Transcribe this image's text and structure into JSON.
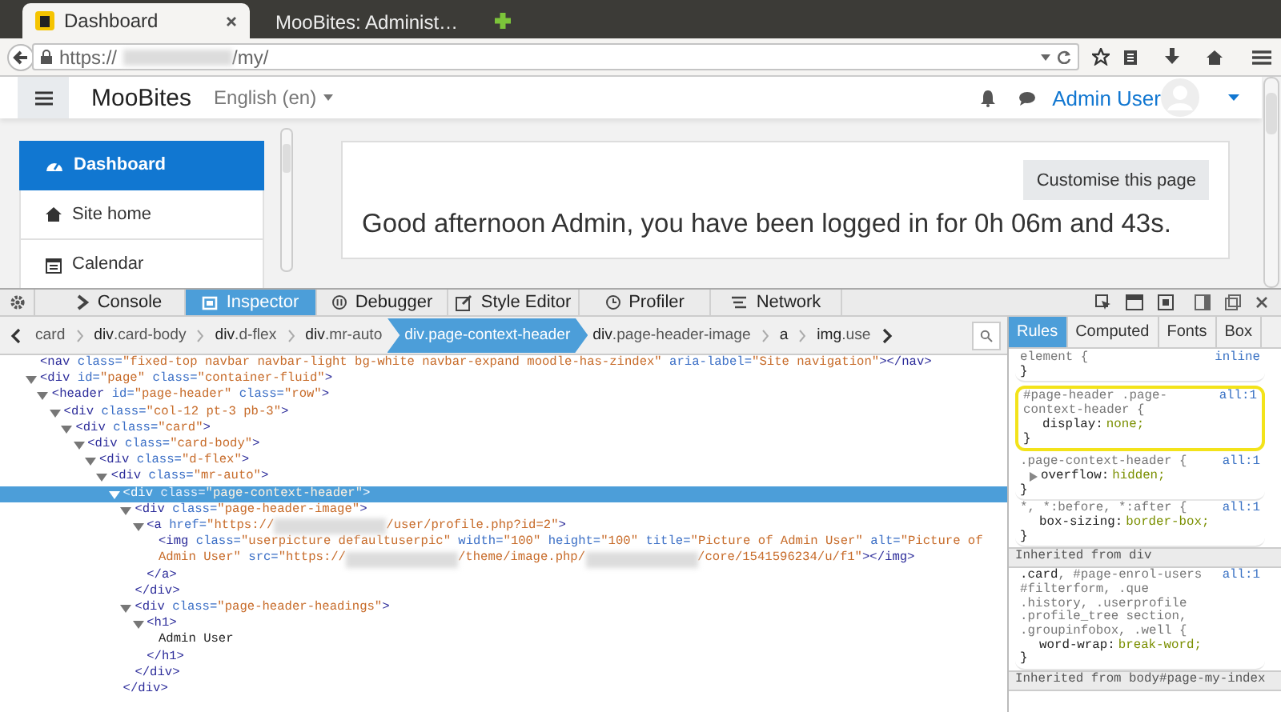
{
  "browser": {
    "tabs": [
      {
        "title": "Dashboard",
        "selected": true
      },
      {
        "title": "MooBites: Administ…",
        "selected": false
      }
    ],
    "url": {
      "prefix": "https://",
      "suffix": "/my/"
    }
  },
  "header": {
    "site_name": "MooBites",
    "language": "English (en)",
    "user_name": "Admin User"
  },
  "sidebar": {
    "items": [
      {
        "label": "Dashboard",
        "kind": "dashboard",
        "selected": true
      },
      {
        "label": "Site home",
        "kind": "home",
        "selected": false
      },
      {
        "label": "Calendar",
        "kind": "calendar",
        "selected": false
      }
    ]
  },
  "content": {
    "button": "Customise this page",
    "greeting": "Good afternoon Admin, you have been logged in for 0h 06m and 43s."
  },
  "devtools": {
    "tabs": [
      {
        "label": "Console",
        "kind": "console",
        "selected": false
      },
      {
        "label": "Inspector",
        "kind": "inspector",
        "selected": true
      },
      {
        "label": "Debugger",
        "kind": "debugger",
        "selected": false
      },
      {
        "label": "Style Editor",
        "kind": "style",
        "selected": false
      },
      {
        "label": "Profiler",
        "kind": "profiler",
        "selected": false
      },
      {
        "label": "Network",
        "kind": "network",
        "selected": false
      }
    ],
    "breadcrumbs": [
      {
        "cls": "card",
        "selected": false
      },
      {
        "tag": "div",
        "cls": ".card-body",
        "selected": false
      },
      {
        "tag": "div",
        "cls": ".d-flex",
        "selected": false
      },
      {
        "tag": "div",
        "cls": ".mr-auto",
        "selected": false
      },
      {
        "tag": "div",
        "cls": ".page-context-header",
        "selected": true
      },
      {
        "tag": "div",
        "cls": ".page-header-image",
        "selected": false
      },
      {
        "tag": "a",
        "selected": false
      },
      {
        "tag": "img",
        "cls": ".use",
        "selected": false
      }
    ],
    "markup": [
      {
        "open": [
          {
            "kind": "tag",
            "text": "<nav"
          },
          {
            "kind": "attr",
            "text": " class="
          },
          {
            "kind": "value",
            "text": "\"fixed-top navbar navbar-light bg-white navbar-expand moodle-has-zindex\""
          },
          {
            "kind": "attr",
            "text": " aria-label="
          },
          {
            "kind": "value",
            "text": "\"Site navigation\""
          },
          {
            "kind": "tag",
            "text": "></nav>"
          }
        ],
        "selected": false
      },
      {
        "open": [
          {
            "kind": "tag",
            "text": "<div"
          },
          {
            "kind": "attr",
            "text": " id="
          },
          {
            "kind": "value",
            "text": "\"page\""
          },
          {
            "kind": "attr",
            "text": " class="
          },
          {
            "kind": "value",
            "text": "\"container-fluid\""
          },
          {
            "kind": "tag",
            "text": ">"
          }
        ],
        "selected": false,
        "expanded": true,
        "children": [
          {
            "open": [
              {
                "kind": "tag",
                "text": "<header"
              },
              {
                "kind": "attr",
                "text": " id="
              },
              {
                "kind": "value",
                "text": "\"page-header\""
              },
              {
                "kind": "attr",
                "text": " class="
              },
              {
                "kind": "value",
                "text": "\"row\""
              },
              {
                "kind": "tag",
                "text": ">"
              }
            ],
            "selected": false,
            "expanded": true,
            "children": [
              {
                "open": [
                  {
                    "kind": "tag",
                    "text": "<div"
                  },
                  {
                    "kind": "attr",
                    "text": " class="
                  },
                  {
                    "kind": "value",
                    "text": "\"col-12 pt-3 pb-3\""
                  },
                  {
                    "kind": "tag",
                    "text": ">"
                  }
                ],
                "selected": false,
                "expanded": true,
                "children": [
                  {
                    "open": [
                      {
                        "kind": "tag",
                        "text": "<div"
                      },
                      {
                        "kind": "attr",
                        "text": " class="
                      },
                      {
                        "kind": "value",
                        "text": "\"card\""
                      },
                      {
                        "kind": "tag",
                        "text": ">"
                      }
                    ],
                    "selected": false,
                    "expanded": true,
                    "children": [
                      {
                        "open": [
                          {
                            "kind": "tag",
                            "text": "<div"
                          },
                          {
                            "kind": "attr",
                            "text": " class="
                          },
                          {
                            "kind": "value",
                            "text": "\"card-body\""
                          },
                          {
                            "kind": "tag",
                            "text": ">"
                          }
                        ],
                        "selected": false,
                        "expanded": true,
                        "children": [
                          {
                            "open": [
                              {
                                "kind": "tag",
                                "text": "<div"
                              },
                              {
                                "kind": "attr",
                                "text": " class="
                              },
                              {
                                "kind": "value",
                                "text": "\"d-flex\""
                              },
                              {
                                "kind": "tag",
                                "text": ">"
                              }
                            ],
                            "selected": false,
                            "expanded": true,
                            "children": [
                              {
                                "open": [
                                  {
                                    "kind": "tag",
                                    "text": "<div"
                                  },
                                  {
                                    "kind": "attr",
                                    "text": " class="
                                  },
                                  {
                                    "kind": "value",
                                    "text": "\"mr-auto\""
                                  },
                                  {
                                    "kind": "tag",
                                    "text": ">"
                                  }
                                ],
                                "selected": false,
                                "expanded": true,
                                "children": [
                                  {
                                    "open": [
                                      {
                                        "kind": "tag",
                                        "text": "<div"
                                      },
                                      {
                                        "kind": "attr",
                                        "text": " class="
                                      },
                                      {
                                        "kind": "value",
                                        "text": "\"page-context-header\""
                                      },
                                      {
                                        "kind": "tag",
                                        "text": ">"
                                      }
                                    ],
                                    "selected": true,
                                    "expanded": true,
                                    "close": [
                                      {
                                        "kind": "tag",
                                        "text": "</div>"
                                      }
                                    ],
                                    "children": [
                                      {
                                        "open": [
                                          {
                                            "kind": "tag",
                                            "text": "<div"
                                          },
                                          {
                                            "kind": "attr",
                                            "text": " class="
                                          },
                                          {
                                            "kind": "value",
                                            "text": "\"page-header-image\""
                                          },
                                          {
                                            "kind": "tag",
                                            "text": ">"
                                          }
                                        ],
                                        "selected": false,
                                        "expanded": true,
                                        "close": [
                                          {
                                            "kind": "tag",
                                            "text": "</div>"
                                          }
                                        ],
                                        "children": [
                                          {
                                            "open": [
                                              {
                                                "kind": "tag",
                                                "text": "<a"
                                              },
                                              {
                                                "kind": "attr",
                                                "text": " href="
                                              },
                                              {
                                                "kind": "value",
                                                "text": "\"https://"
                                              },
                                              {
                                                "kind": "redacted"
                                              },
                                              {
                                                "kind": "value",
                                                "text": "/user/profile.php?id=2\""
                                              },
                                              {
                                                "kind": "tag",
                                                "text": ">"
                                              }
                                            ],
                                            "selected": false,
                                            "expanded": true,
                                            "close": [
                                              {
                                                "kind": "tag",
                                                "text": "</a>"
                                              }
                                            ],
                                            "children": [
                                              {
                                                "open": [
                                                  {
                                                    "kind": "tag",
                                                    "text": "<img"
                                                  },
                                                  {
                                                    "kind": "attr",
                                                    "text": " class="
                                                  },
                                                  {
                                                    "kind": "value",
                                                    "text": "\"userpicture defaultuserpic\""
                                                  },
                                                  {
                                                    "kind": "attr",
                                                    "text": " width="
                                                  },
                                                  {
                                                    "kind": "value",
                                                    "text": "\"100\""
                                                  },
                                                  {
                                                    "kind": "attr",
                                                    "text": " height="
                                                  },
                                                  {
                                                    "kind": "value",
                                                    "text": "\"100\""
                                                  },
                                                  {
                                                    "kind": "attr",
                                                    "text": " title="
                                                  },
                                                  {
                                                    "kind": "value",
                                                    "text": "\"Picture of Admin User\""
                                                  },
                                                  {
                                                    "kind": "attr",
                                                    "text": " alt="
                                                  },
                                                  {
                                                    "kind": "value",
                                                    "text": "\"Picture of"
                                                  },
                                                  {
                                                    "kind": "break"
                                                  },
                                                  {
                                                    "kind": "value",
                                                    "text": "Admin User\""
                                                  },
                                                  {
                                                    "kind": "attr",
                                                    "text": " src="
                                                  },
                                                  {
                                                    "kind": "value",
                                                    "text": "\"https://"
                                                  },
                                                  {
                                                    "kind": "redacted"
                                                  },
                                                  {
                                                    "kind": "value",
                                                    "text": "/theme/image.php/"
                                                  },
                                                  {
                                                    "kind": "redacted"
                                                  },
                                                  {
                                                    "kind": "value",
                                                    "text": "/core/1541596234/u/f1\""
                                                  },
                                                  {
                                                    "kind": "tag",
                                                    "text": "></img>"
                                                  }
                                                ],
                                                "selected": false
                                              }
                                            ]
                                          }
                                        ]
                                      },
                                      {
                                        "open": [
                                          {
                                            "kind": "tag",
                                            "text": "<div"
                                          },
                                          {
                                            "kind": "attr",
                                            "text": " class="
                                          },
                                          {
                                            "kind": "value",
                                            "text": "\"page-header-headings\""
                                          },
                                          {
                                            "kind": "tag",
                                            "text": ">"
                                          }
                                        ],
                                        "selected": false,
                                        "expanded": true,
                                        "close": [
                                          {
                                            "kind": "tag",
                                            "text": "</div>"
                                          }
                                        ],
                                        "children": [
                                          {
                                            "open": [
                                              {
                                                "kind": "tag",
                                                "text": "<h1"
                                              },
                                              {
                                                "kind": "tag",
                                                "text": ">"
                                              }
                                            ],
                                            "selected": false,
                                            "expanded": true,
                                            "close": [
                                              {
                                                "kind": "tag",
                                                "text": "</h1>"
                                              }
                                            ],
                                            "children": [
                                              {
                                                "open": [
                                                  {
                                                    "kind": "text",
                                                    "text": "Admin User"
                                                  }
                                                ],
                                                "selected": false
                                              }
                                            ]
                                          }
                                        ]
                                      }
                                    ]
                                  }
                                ]
                              }
                            ]
                          }
                        ]
                      }
                    ]
                  }
                ]
              }
            ]
          }
        ]
      }
    ],
    "rules_tabs": [
      {
        "label": "Rules",
        "selected": true
      },
      {
        "label": "Computed",
        "selected": false
      },
      {
        "label": "Fonts",
        "selected": false
      },
      {
        "label": "Box",
        "selected": false
      }
    ],
    "rules": [
      {
        "kind": "rule",
        "selector": "element {",
        "source": "inline",
        "close": "}",
        "highlighted": false
      },
      {
        "kind": "rule",
        "selector": "#page-header .page-context-header {",
        "source": "all:1",
        "close": "}",
        "highlighted": true,
        "declarations": [
          {
            "name": "display:",
            "value": "none;"
          }
        ]
      },
      {
        "kind": "rule",
        "selector": ".page-context-header {",
        "source": "all:1",
        "close": "}",
        "highlighted": false,
        "declarations": [
          {
            "name": "overflow:",
            "value": "hidden;",
            "expandable": true
          }
        ]
      },
      {
        "kind": "rule",
        "selector": "*, *:before, *:after {",
        "source": "all:1",
        "close": "}",
        "highlighted": false,
        "declarations": [
          {
            "name": "box-sizing:",
            "value": "border-box;"
          }
        ]
      },
      {
        "kind": "inherited",
        "label": "Inherited from div"
      },
      {
        "kind": "rule",
        "selector": "**.card**, #page-enrol-users #filterform, .que .history, .userprofile .profile_tree section, .groupinfobox, .well {",
        "source": "all:1",
        "close": "}",
        "highlighted": false,
        "declarations": [
          {
            "name": "word-wrap:",
            "value": "break-word;"
          }
        ]
      },
      {
        "kind": "inherited",
        "label": "Inherited from body#page-my-index"
      }
    ]
  }
}
